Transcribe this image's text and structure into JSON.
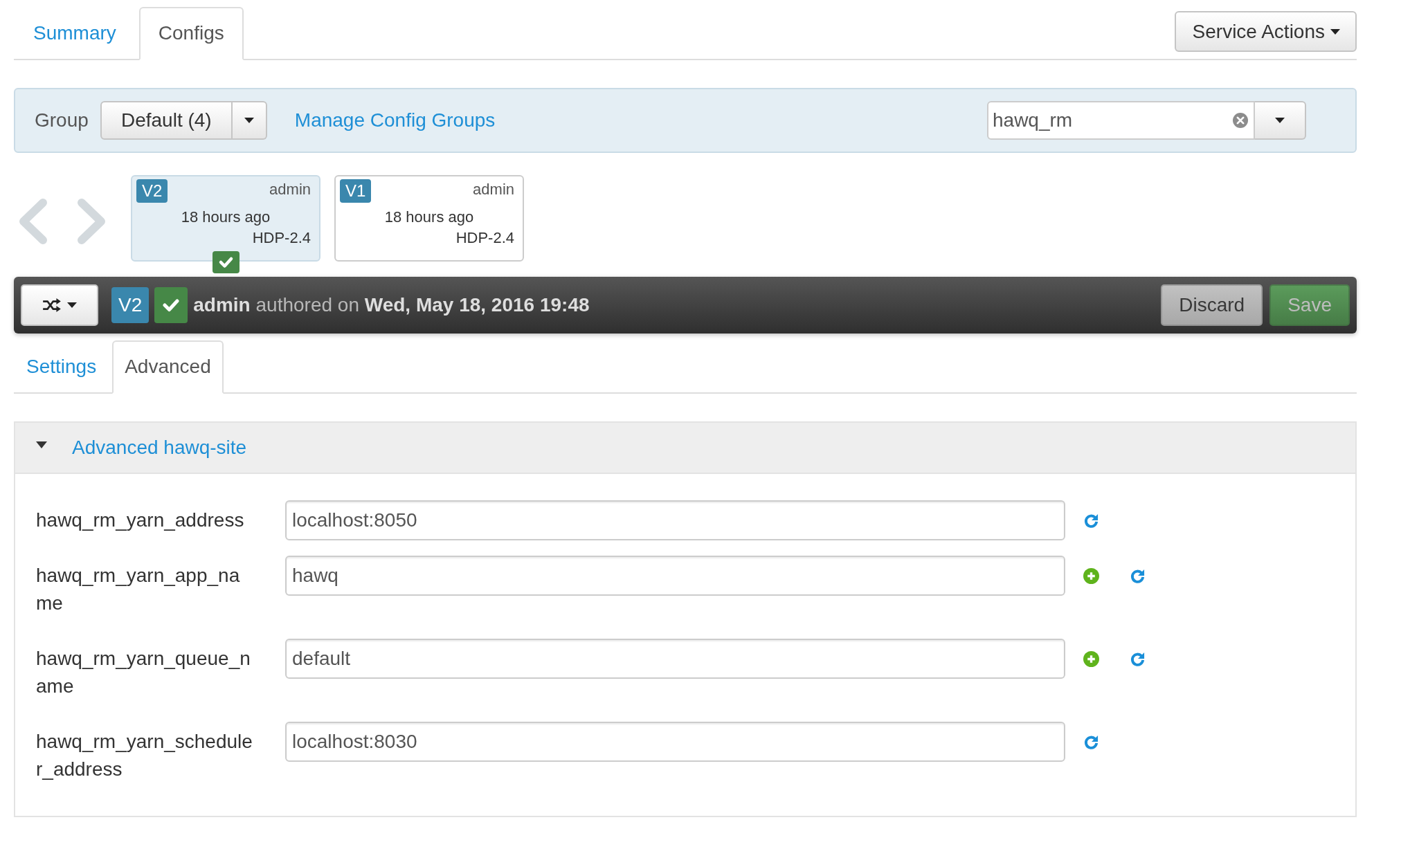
{
  "tabs": [
    {
      "label": "Summary",
      "selected": false
    },
    {
      "label": "Configs",
      "selected": true
    }
  ],
  "service_actions": {
    "label": "Service Actions"
  },
  "group_bar": {
    "label": "Group",
    "group_dropdown": {
      "value": "Default (4)"
    },
    "manage_link": "Manage Config Groups",
    "filter": {
      "value": "hawq_rm"
    }
  },
  "versions": [
    {
      "version": "V2",
      "author": "admin",
      "time": "18 hours ago",
      "stack": "HDP-2.4",
      "selected": true,
      "current": true
    },
    {
      "version": "V1",
      "author": "admin",
      "time": "18 hours ago",
      "stack": "HDP-2.4",
      "selected": false,
      "current": false
    }
  ],
  "version_bar": {
    "version": "V2",
    "current": true,
    "summary": "**admin** authored on **Wed, May 18, 2016 19:48**",
    "buttons": [
      {
        "label": "Discard",
        "kind": "discard",
        "disabled": true
      },
      {
        "label": "Save",
        "kind": "save",
        "disabled": true
      }
    ]
  },
  "subtabs": [
    {
      "label": "Settings",
      "selected": false
    },
    {
      "label": "Advanced",
      "selected": true
    }
  ],
  "section": {
    "title": "Advanced hawq-site",
    "expanded": true,
    "properties": [
      {
        "name": "hawq_rm_yarn_address",
        "value": "localhost:8050",
        "overridable": false
      },
      {
        "name": "hawq_rm_yarn_app_name",
        "value": "hawq",
        "overridable": true
      },
      {
        "name": "hawq_rm_yarn_queue_name",
        "value": "default",
        "overridable": true
      },
      {
        "name": "hawq_rm_yarn_scheduler_address",
        "value": "localhost:8030",
        "overridable": false
      }
    ]
  }
}
